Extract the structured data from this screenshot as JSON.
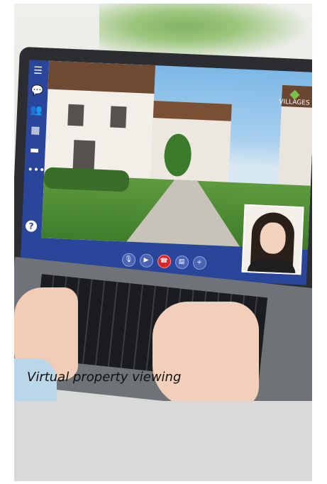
{
  "card": {
    "caption": "Virtual property viewing"
  },
  "screen": {
    "brand_logo_text": "VILLAGES",
    "sidebar_icons": [
      "menu-icon",
      "chat-icon",
      "group-icon",
      "calendar-icon",
      "folder-icon",
      "more-icon"
    ],
    "help_symbol": "?",
    "call_controls": [
      "mic-off-icon",
      "video-icon",
      "end-call-icon",
      "document-icon",
      "add-person-icon"
    ]
  },
  "colors": {
    "app_blue": "#2a469b",
    "end_call_red": "#d8262a",
    "placeholder_gray": "#d9d9d9"
  }
}
